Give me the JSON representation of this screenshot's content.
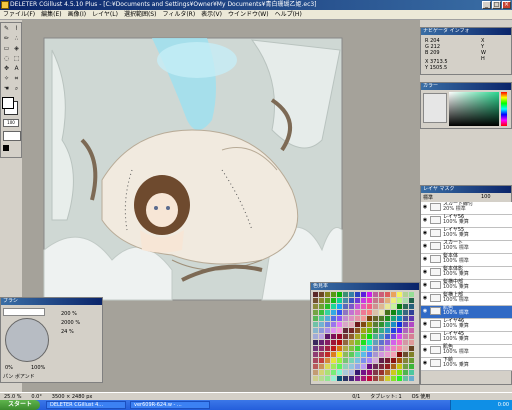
{
  "window": {
    "title": "DELETER CGillust 4.5.10 Plus - [C:¥Documents and Settings¥Owner¥My Documents¥青白珊瑚乙姫.ec3]",
    "minimize": "_",
    "maximize": "□",
    "close": "×"
  },
  "menu": [
    "ファイル(F)",
    "編集(E)",
    "画像(I)",
    "レイヤ(L)",
    "選択範囲(S)",
    "フィルタ(R)",
    "表示(V)",
    "ウインドウ(W)",
    "ヘルプ(H)"
  ],
  "info_panel": {
    "title": "ナビゲータ",
    "tab2": "インフォ",
    "r_label": "R",
    "r": "204",
    "g_label": "G",
    "g": "212",
    "b_label": "B",
    "b": "209",
    "x_label": "X",
    "x": "3713.5",
    "y_label": "Y",
    "y": "1505.5",
    "xx": "X",
    "yy": "Y",
    "w": "W",
    "h": "H"
  },
  "color_panel": {
    "title": "カラー"
  },
  "brush_panel": {
    "title": "ブラシ",
    "size1": "200",
    "size2": "2000",
    "size3": "24",
    "pct1": "%",
    "pct2": "%",
    "pct3": "%",
    "label": "パン ボアンド",
    "zero": "0%",
    "hundred": "100%"
  },
  "palette_panel": {
    "title": "色見本"
  },
  "layers_panel": {
    "title": "レイヤ",
    "tab2": "マスク",
    "mode": "標準",
    "opacity": "100",
    "layers": [
      {
        "name": "スカート線付",
        "mode": "20% 標準"
      },
      {
        "name": "レイヤ56",
        "mode": "100% 乗算"
      },
      {
        "name": "レイヤ55",
        "mode": "100% 乗算"
      },
      {
        "name": "スカート",
        "mode": "100% 標準"
      },
      {
        "name": "髪本体",
        "mode": "100% 標準"
      },
      {
        "name": "髪本体影",
        "mode": "100% 乗算"
      },
      {
        "name": "髪横中部",
        "mode": "100% 乗算"
      },
      {
        "name": "髪横上部",
        "mode": "100% 標準"
      },
      {
        "name": "肌色",
        "mode": "100% 標準",
        "selected": true
      },
      {
        "name": "レイヤ46",
        "mode": "100% 乗算"
      },
      {
        "name": "レイヤ45",
        "mode": "100% 乗算"
      },
      {
        "name": "肌色",
        "mode": "100% 標準"
      },
      {
        "name": "下絵",
        "mode": "100% 乗算"
      }
    ]
  },
  "status": {
    "zoom": "25.0 %",
    "angle": "0.0°",
    "size": "3500 × 2480 px",
    "tablet": "タブレット: 1",
    "selection": "0/1",
    "memory": "OS 使用"
  },
  "taskbar": {
    "start": "スタート",
    "task1": "DELETER CGillust 4...",
    "task2": "ver609R-624.w - ...",
    "tray_time": "0:00"
  },
  "colors": {
    "accent": "#0a246a",
    "selected_layer": "#316ac5",
    "canvas_bg": "#a5a29a"
  }
}
